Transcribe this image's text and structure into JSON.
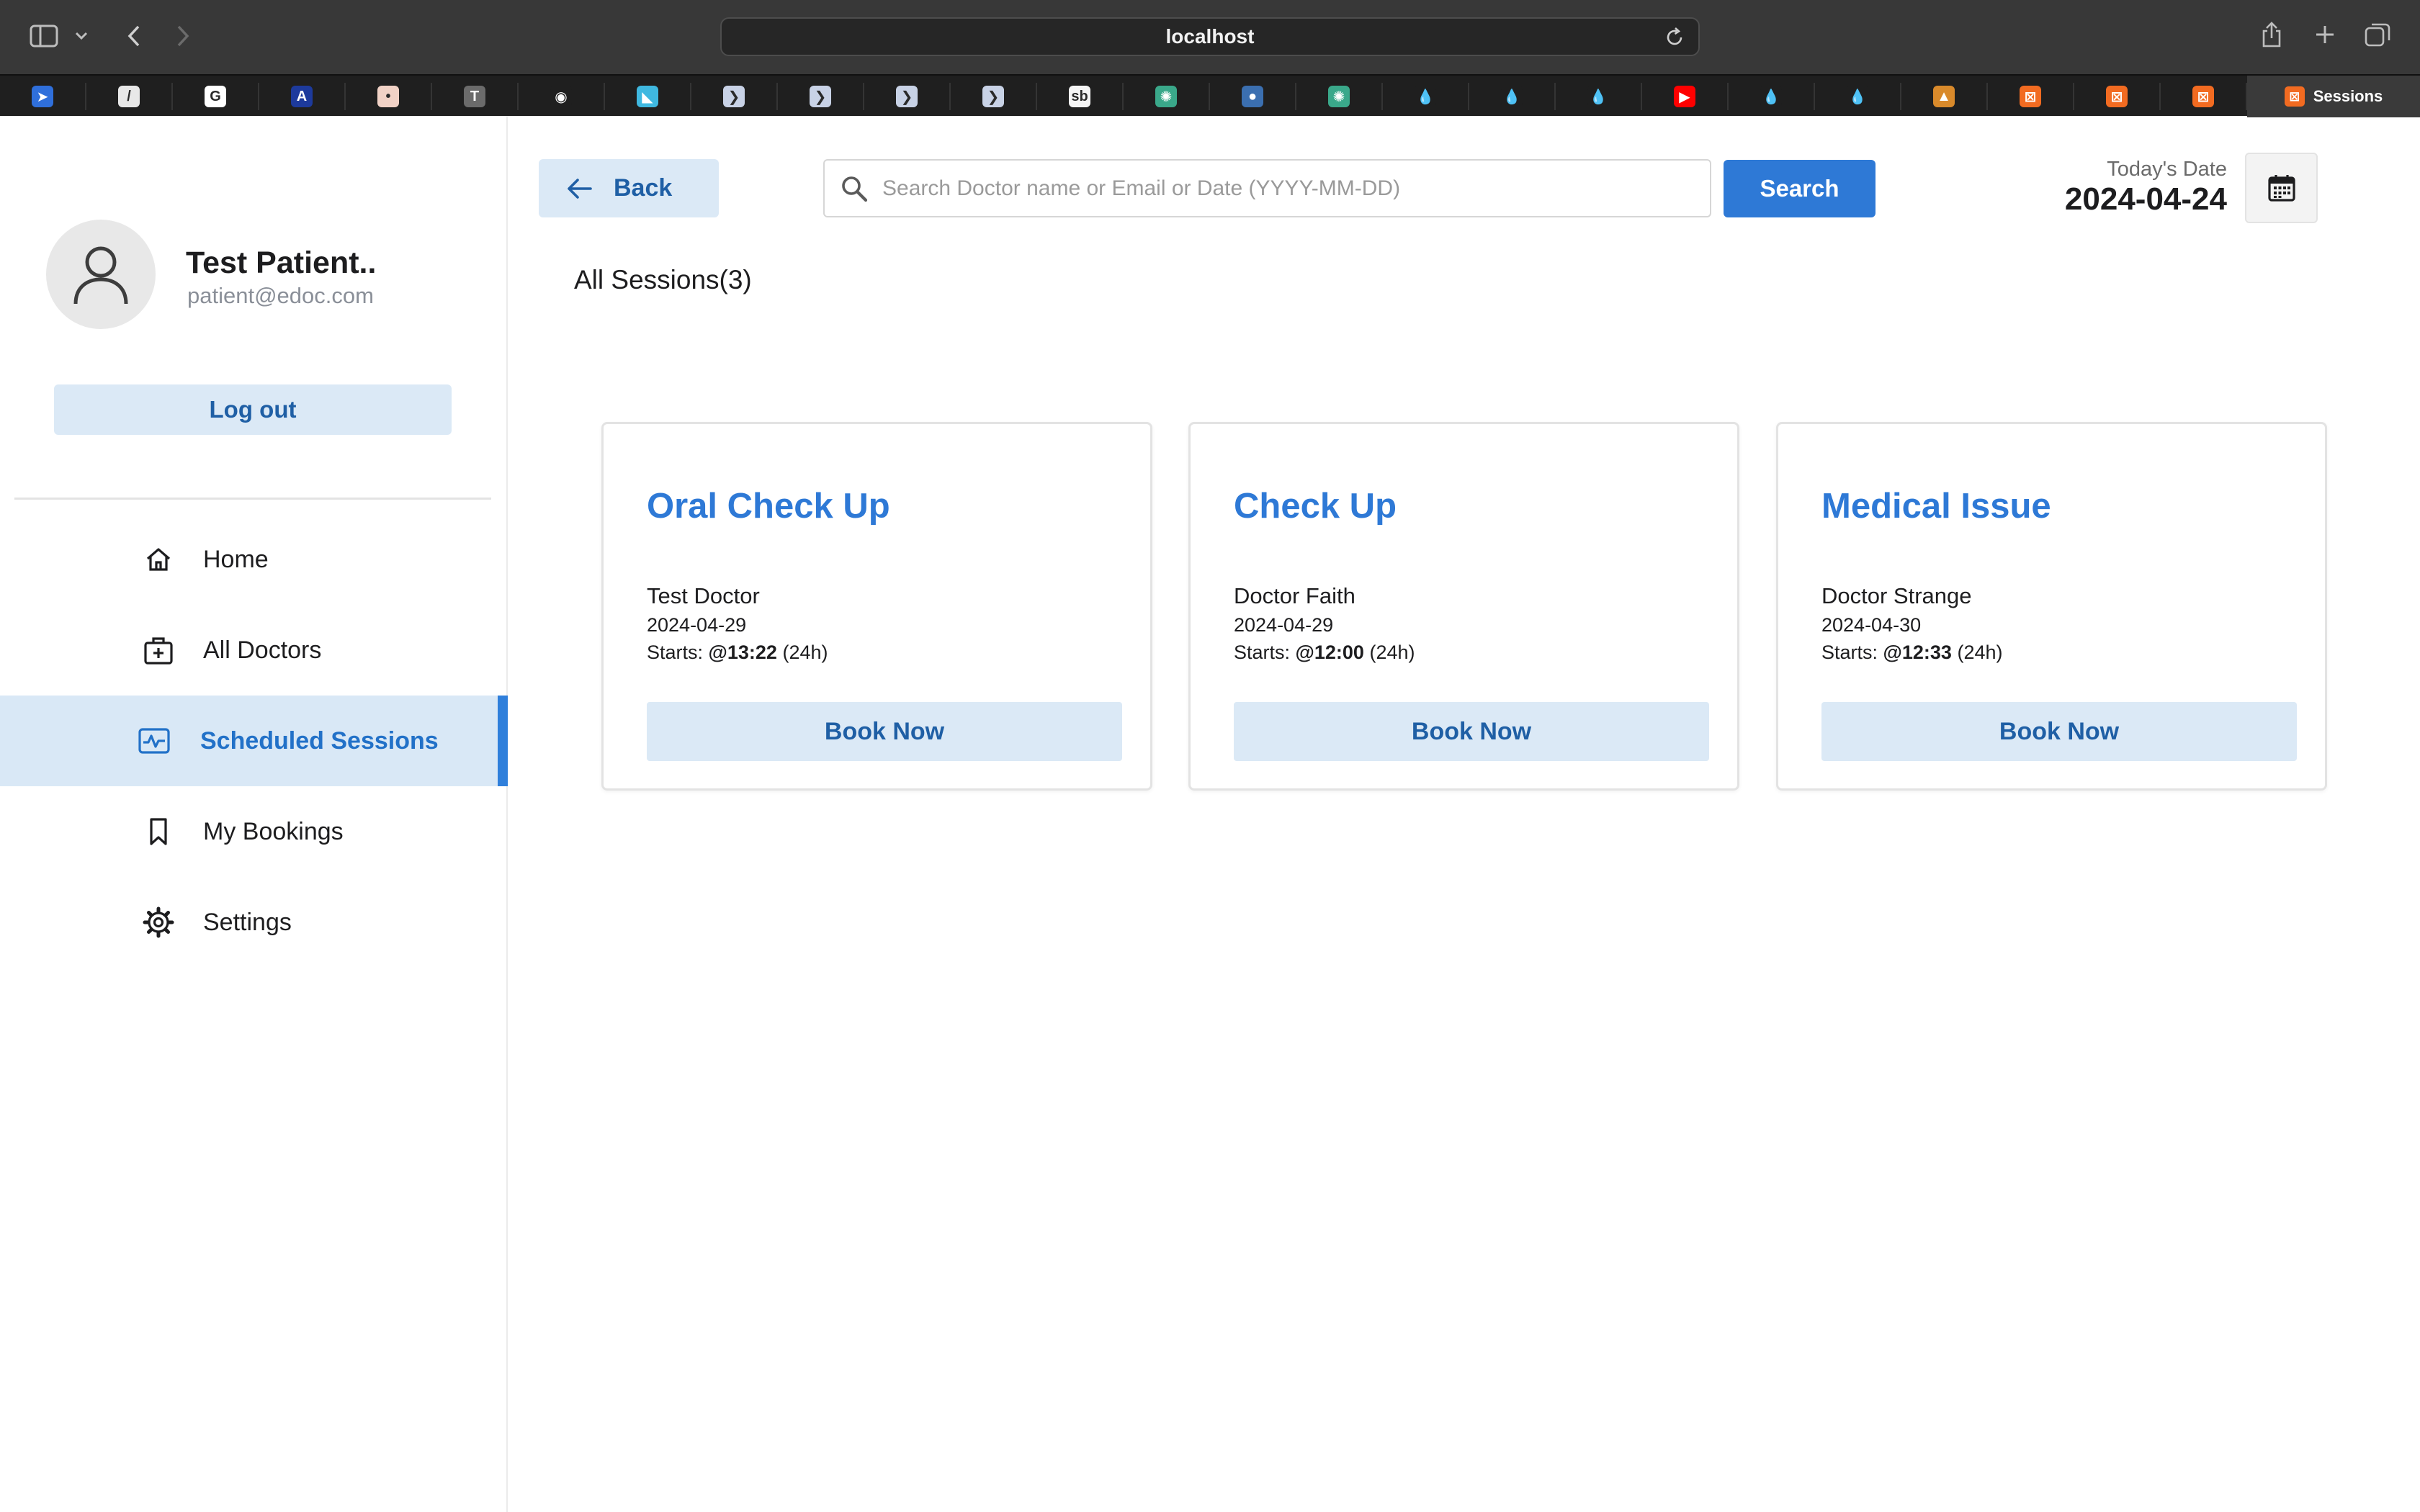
{
  "browser": {
    "url": "localhost",
    "active_tab": "Sessions",
    "favorites": [
      {
        "icon": "blue-arrow-favicon",
        "color": "#2f6fdb",
        "glyph": "➤"
      },
      {
        "icon": "red-slash-favicon",
        "color": "#e8e8e8",
        "glyph": "/"
      },
      {
        "icon": "google-favicon",
        "color": "#ffffff",
        "glyph": "G"
      },
      {
        "icon": "blue-logo-favicon",
        "color": "#1d3a9c",
        "glyph": "A"
      },
      {
        "icon": "pink-square-favicon",
        "color": "#f1d2c6",
        "glyph": "•"
      },
      {
        "icon": "t-favicon",
        "color": "#6b6b6b",
        "glyph": "T"
      },
      {
        "icon": "github-favicon",
        "color": "#1f1f1f",
        "glyph": "◉"
      },
      {
        "icon": "teal-triangle-favicon",
        "color": "#3fb8e0",
        "glyph": "◣"
      },
      {
        "icon": "next-arrow-favicon",
        "color": "#c8d2e6",
        "glyph": "❯"
      },
      {
        "icon": "next-arrow-favicon",
        "color": "#c8d2e6",
        "glyph": "❯"
      },
      {
        "icon": "next-arrow-favicon",
        "color": "#c8d2e6",
        "glyph": "❯"
      },
      {
        "icon": "next-arrow-favicon",
        "color": "#c8d2e6",
        "glyph": "❯"
      },
      {
        "icon": "sb-favicon",
        "color": "#f5f5f5",
        "glyph": "sb"
      },
      {
        "icon": "openai-favicon",
        "color": "#3aa88a",
        "glyph": "✺"
      },
      {
        "icon": "python-favicon",
        "color": "#3b6fb0",
        "glyph": "●"
      },
      {
        "icon": "openai-favicon",
        "color": "#3aa88a",
        "glyph": "✺"
      },
      {
        "icon": "drupal-favicon",
        "color": "#1f1f1f",
        "glyph": "💧"
      },
      {
        "icon": "drupal-favicon",
        "color": "#1f1f1f",
        "glyph": "💧"
      },
      {
        "icon": "drupal-favicon",
        "color": "#1f1f1f",
        "glyph": "💧"
      },
      {
        "icon": "youtube-favicon",
        "color": "#ff0000",
        "glyph": "▶"
      },
      {
        "icon": "drupal-favicon",
        "color": "#1f1f1f",
        "glyph": "💧"
      },
      {
        "icon": "drupal-favicon",
        "color": "#1f1f1f",
        "glyph": "💧"
      },
      {
        "icon": "mountain-favicon",
        "color": "#d98a2b",
        "glyph": "▲"
      },
      {
        "icon": "xampp-favicon",
        "color": "#f26b21",
        "glyph": "⊠"
      },
      {
        "icon": "xampp-favicon",
        "color": "#f26b21",
        "glyph": "⊠"
      },
      {
        "icon": "xampp-favicon",
        "color": "#f26b21",
        "glyph": "⊠"
      }
    ]
  },
  "profile": {
    "name": "Test Patient..",
    "email": "patient@edoc.com",
    "logout_label": "Log out"
  },
  "nav": {
    "items": [
      {
        "label": "Home",
        "icon": "home-icon"
      },
      {
        "label": "All Doctors",
        "icon": "doctor-bag-icon"
      },
      {
        "label": "Scheduled Sessions",
        "icon": "sessions-icon",
        "active": true
      },
      {
        "label": "My Bookings",
        "icon": "bookmark-icon"
      },
      {
        "label": "Settings",
        "icon": "gear-icon"
      }
    ]
  },
  "toolbar": {
    "back_label": "Back",
    "search_placeholder": "Search Doctor name or Email or Date (YYYY-MM-DD)",
    "search_value": "",
    "search_label": "Search",
    "date_caption": "Today's Date",
    "date_value": "2024-04-24"
  },
  "sessions": {
    "title": "All Sessions(3)",
    "book_label": "Book Now",
    "starts_prefix": "Starts:",
    "starts_suffix": "(24h)",
    "items": [
      {
        "title": "Oral Check Up",
        "doctor": "Test Doctor",
        "date": "2024-04-29",
        "time": "@13:22"
      },
      {
        "title": "Check Up",
        "doctor": "Doctor Faith",
        "date": "2024-04-29",
        "time": "@12:00"
      },
      {
        "title": "Medical Issue",
        "doctor": "Doctor Strange",
        "date": "2024-04-30",
        "time": "@12:33"
      }
    ]
  },
  "colors": {
    "accent": "#2e79d6",
    "accent_soft": "#dbe9f6",
    "active_marker": "#2f7fdb"
  }
}
